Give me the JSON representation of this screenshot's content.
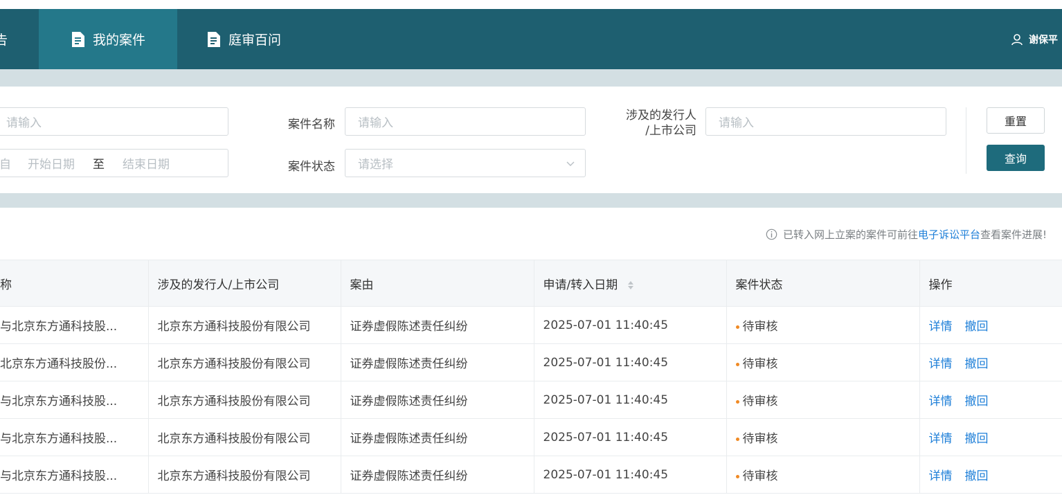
{
  "nav": {
    "cut_item": "告",
    "active_item": "我的案件",
    "trial_item": "庭审百问",
    "user_name": "谢保平"
  },
  "filter": {
    "first_placeholder": "请输入",
    "date_cut_label": "自",
    "date_start_placeholder": "开始日期",
    "date_separator": "至",
    "date_end_placeholder": "结束日期",
    "case_name_label": "案件名称",
    "case_name_placeholder": "请输入",
    "case_status_label": "案件状态",
    "case_status_placeholder": "请选择",
    "issuer_label_line1": "涉及的发行人",
    "issuer_label_line2": "/上市公司",
    "issuer_placeholder": "请输入",
    "reset_label": "重置",
    "query_label": "查询"
  },
  "notice": {
    "prefix": "已转入网上立案的案件可前往",
    "link": "电子诉讼平台",
    "suffix": "查看案件进展!"
  },
  "table": {
    "columns": [
      "称",
      "涉及的发行人/上市公司",
      "案由",
      "申请/转入日期",
      "案件状态",
      "操作"
    ],
    "rows": [
      {
        "name": "与北京东方通科技股...",
        "issuer": "北京东方通科技股份有限公司",
        "cause": "证券虚假陈述责任纠纷",
        "date": "2025-07-01 11:40:45",
        "status": "待审核",
        "op_detail": "详情",
        "op_withdraw": "撤回"
      },
      {
        "name": "北京东方通科技股份...",
        "issuer": "北京东方通科技股份有限公司",
        "cause": "证券虚假陈述责任纠纷",
        "date": "2025-07-01 11:40:45",
        "status": "待审核",
        "op_detail": "详情",
        "op_withdraw": "撤回"
      },
      {
        "name": "与北京东方通科技股...",
        "issuer": "北京东方通科技股份有限公司",
        "cause": "证券虚假陈述责任纠纷",
        "date": "2025-07-01 11:40:45",
        "status": "待审核",
        "op_detail": "详情",
        "op_withdraw": "撤回"
      },
      {
        "name": "与北京东方通科技股...",
        "issuer": "北京东方通科技股份有限公司",
        "cause": "证券虚假陈述责任纠纷",
        "date": "2025-07-01 11:40:45",
        "status": "待审核",
        "op_detail": "详情",
        "op_withdraw": "撤回"
      },
      {
        "name": "与北京东方通科技股...",
        "issuer": "北京东方通科技股份有限公司",
        "cause": "证券虚假陈述责任纠纷",
        "date": "2025-07-01 11:40:45",
        "status": "待审核",
        "op_detail": "详情",
        "op_withdraw": "撤回"
      }
    ]
  },
  "colors": {
    "nav_bg": "#1e5f70",
    "nav_active_bg": "#24788a",
    "primary_button": "#1e6b7c",
    "link": "#1e7fd8",
    "status_pending_dot": "#f08a24"
  },
  "icons": {
    "nav_doc": "document-icon",
    "user": "user-icon",
    "select": "chevron-down-icon",
    "sort": "sort-icon",
    "notice": "info-icon"
  }
}
